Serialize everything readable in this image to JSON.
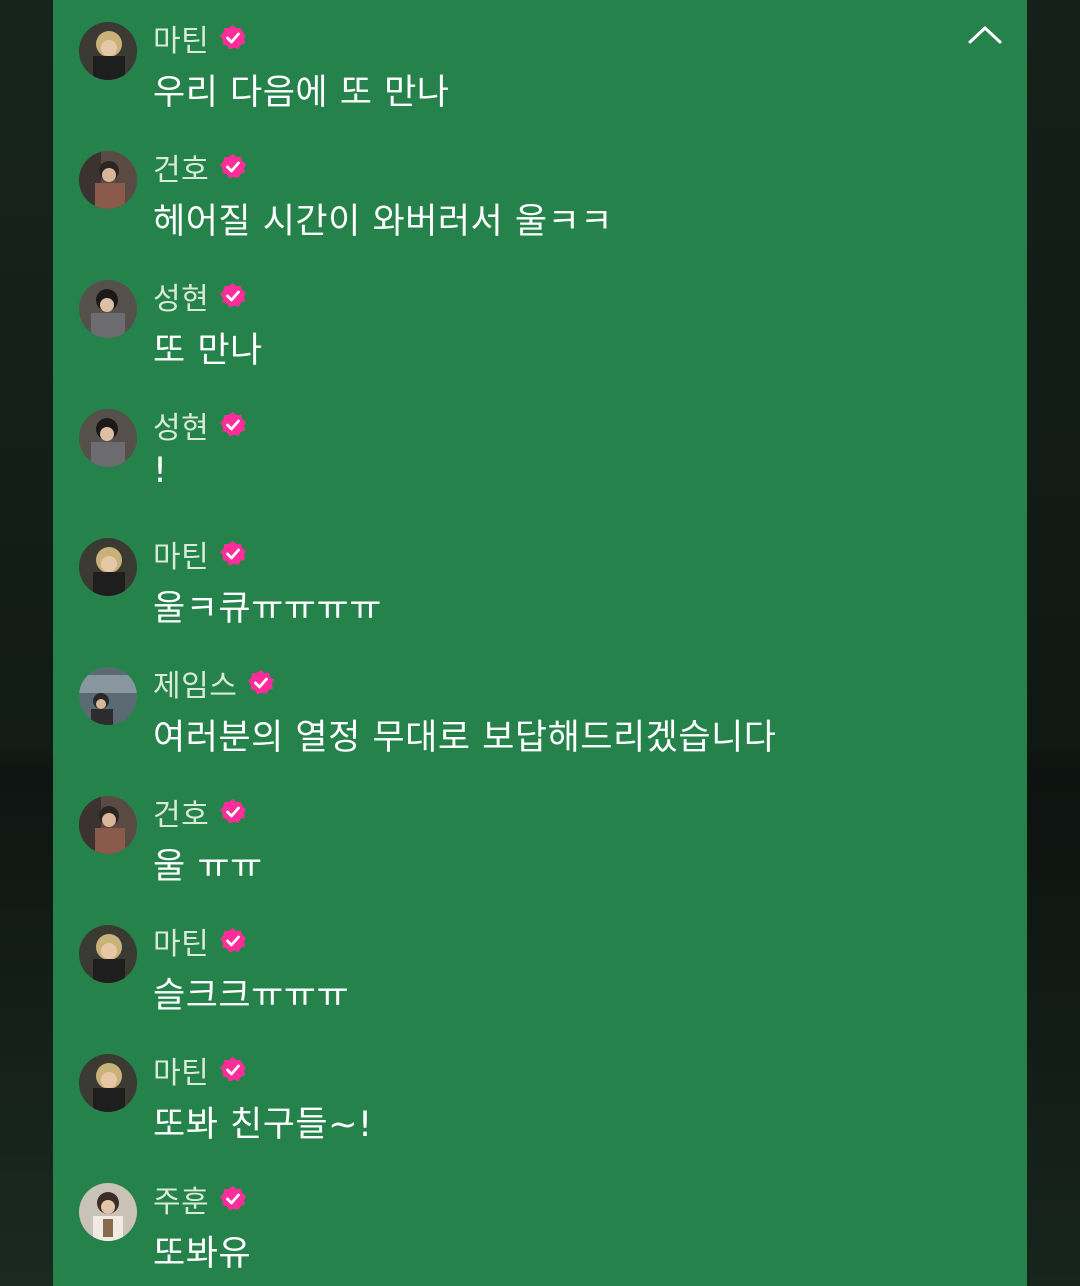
{
  "icons": {
    "collapse": "chevron-up-icon",
    "verified": "verified-badge-icon"
  },
  "colors": {
    "panel": "#24824a",
    "badge": "#ff2d9a",
    "name_text": "#d9ead9",
    "message_text": "#ffffff"
  },
  "messages": [
    {
      "name": "마틴",
      "text": "우리 다음에 또 만나"
    },
    {
      "name": "건호",
      "text": "헤어질 시간이 와버러서 울ㅋㅋ"
    },
    {
      "name": "성현",
      "text": "또 만나"
    },
    {
      "name": "성현",
      "text": "!"
    },
    {
      "name": "마틴",
      "text": "울ㅋ큐ㅠㅠㅠㅠ"
    },
    {
      "name": "제임스",
      "text": "여러분의 열정 무대로 보답해드리겠습니다"
    },
    {
      "name": "건호",
      "text": "울 ㅠㅠ"
    },
    {
      "name": "마틴",
      "text": "슬크크ㅠㅠㅠ"
    },
    {
      "name": "마틴",
      "text": "또봐 친구들~!"
    },
    {
      "name": "주훈",
      "text": "또봐유"
    }
  ]
}
